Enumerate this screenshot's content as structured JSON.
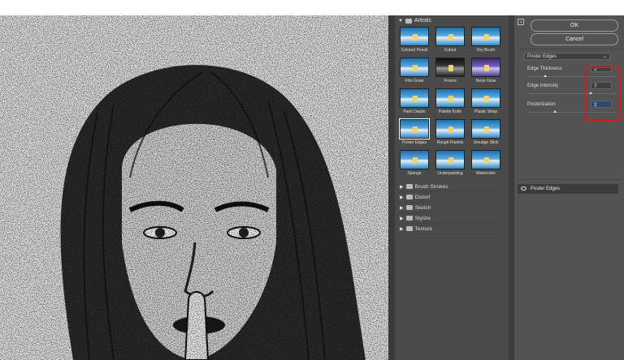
{
  "gallery": {
    "category": "Artistic",
    "filters": [
      {
        "label": "Colored Pencil"
      },
      {
        "label": "Cutout"
      },
      {
        "label": "Dry Brush"
      },
      {
        "label": "Film Grain"
      },
      {
        "label": "Fresco"
      },
      {
        "label": "Neon Glow"
      },
      {
        "label": "Paint Daubs"
      },
      {
        "label": "Palette Knife"
      },
      {
        "label": "Plastic Wrap"
      },
      {
        "label": "Poster Edges"
      },
      {
        "label": "Rough Pastels"
      },
      {
        "label": "Smudge Stick"
      },
      {
        "label": "Sponge"
      },
      {
        "label": "Underpainting"
      },
      {
        "label": "Watercolor"
      }
    ],
    "selected": "Poster Edges",
    "other_categories": [
      {
        "label": "Brush Strokes"
      },
      {
        "label": "Distort"
      },
      {
        "label": "Sketch"
      },
      {
        "label": "Stylize"
      },
      {
        "label": "Texture"
      }
    ]
  },
  "controls": {
    "ok_label": "OK",
    "cancel_label": "Cancel",
    "filter_select": "Poster Edges",
    "params": [
      {
        "label": "Edge Thickness",
        "value": "2"
      },
      {
        "label": "Edge Intensity",
        "value": "7"
      },
      {
        "label": "Posterization",
        "value": "2"
      }
    ],
    "layer_name": "Poster Edges"
  }
}
